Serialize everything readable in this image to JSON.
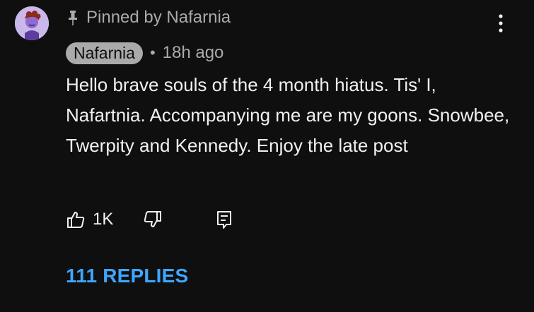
{
  "pinned": {
    "text": "Pinned by Nafarnia",
    "icon": "pin-icon"
  },
  "author": {
    "name": "Nafarnia",
    "separator": "•",
    "time": "18h ago",
    "avatar_icon": "avatar"
  },
  "comment": {
    "text": "Hello brave souls of the 4 month hiatus. Tis' I, Nafartnia. Accompanying me are my goons. Snowbee, Twerpity and Kennedy. Enjoy the late post"
  },
  "actions": {
    "like_count": "1K",
    "like_icon": "thumbs-up-icon",
    "dislike_icon": "thumbs-down-icon",
    "reply_icon": "reply-icon"
  },
  "replies": {
    "label": "111 REPLIES"
  },
  "menu": {
    "icon": "more-vert-icon"
  },
  "colors": {
    "background": "#0f0f0f",
    "text": "#f1f1f1",
    "muted": "#aaaaaa",
    "link": "#3ea6ff",
    "avatar_bg": "#cbb8ea"
  }
}
